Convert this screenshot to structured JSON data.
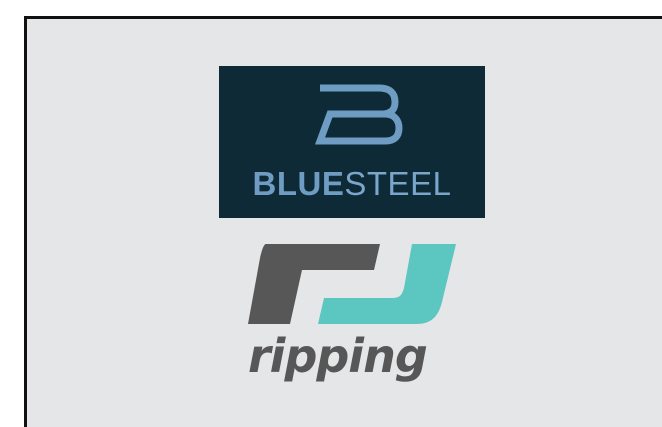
{
  "logos": {
    "bluesteel": {
      "wordmark_bold": "BLUE",
      "wordmark_light": "STEEL",
      "monogram": "B"
    },
    "ripping": {
      "wordmark": "ripping"
    }
  },
  "colors": {
    "page_background": "#e5e6e8",
    "border": "#111111",
    "bluesteel_background": "#0e2a36",
    "bluesteel_blue": "#6f9cc2",
    "ripping_gray": "#575757",
    "ripping_teal": "#5cc6c0"
  }
}
